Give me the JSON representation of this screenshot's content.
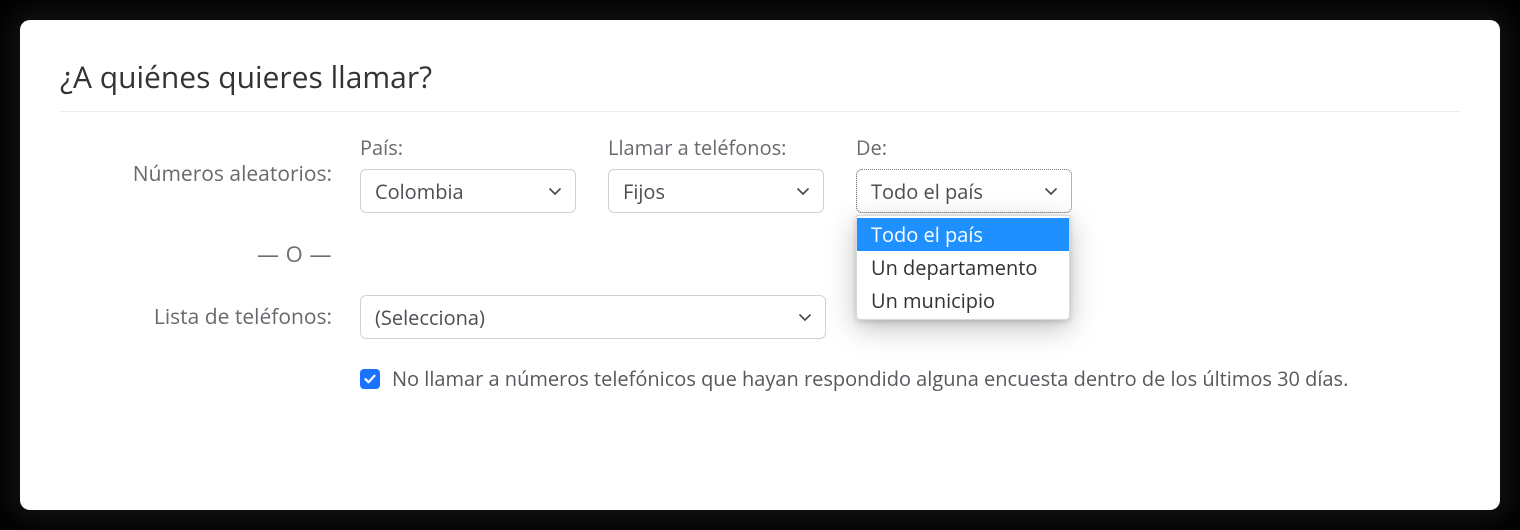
{
  "heading": "¿A quiénes quieres llamar?",
  "labels": {
    "random": "Números aleatorios:",
    "country": "País:",
    "call_phones": "Llamar a teléfonos:",
    "from": "De:",
    "or": "— O —",
    "phone_list": "Lista de teléfonos:"
  },
  "selects": {
    "country_value": "Colombia",
    "phones_value": "Fijos",
    "from_value": "Todo el país",
    "list_value": "(Selecciona)"
  },
  "from_options": {
    "opt0": "Todo el país",
    "opt1": "Un departamento",
    "opt2": "Un municipio"
  },
  "checkbox": {
    "checked": true,
    "label": "No llamar a números telefónicos que hayan respondido alguna encuesta dentro de los últimos 30 días."
  }
}
